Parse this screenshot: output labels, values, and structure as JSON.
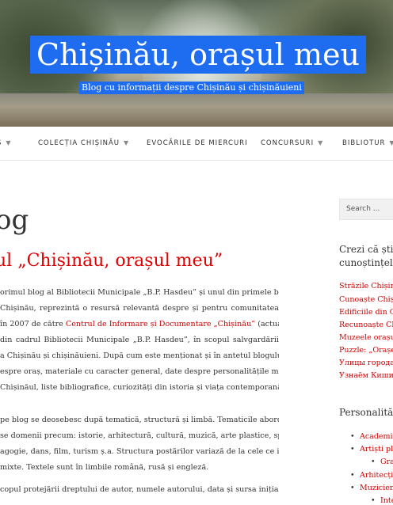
{
  "site": {
    "title": "Chișinău, orașul meu",
    "tagline": "Blog cu informații despre Chișinău și chișinăuieni"
  },
  "nav": {
    "items": [
      {
        "label": "Ș"
      },
      {
        "label": "COLECȚIA CHIȘINĂU"
      },
      {
        "label": "EVOCĂRILE DE MIERCURI"
      },
      {
        "label": "CONCURSURI"
      },
      {
        "label": "BIBLIOTUR"
      }
    ]
  },
  "main": {
    "heading": "og",
    "post_title": "ul „Chișinău, orașul meu”",
    "para1": [
      "orimul blog al Bibliotecii Municipale „B.P. Hasdeu” și unul din primele bloguri",
      "Chișinău, reprezintă o resursă relevantă despre și pentru comunitatea",
      {
        "pre": "în 2007 de către ",
        "link": "Centrul de Informare și Documentare „Chișinău”",
        "post": " (actualmente"
      },
      "din cadrul Bibliotecii Municipale „B.P. Hasdeu”, în scopul salvgardării",
      "a Chișinău și chișinăuieni. După cum este menționat și în antetul blogului în",
      "espre oraș, materiale cu caracter general, date despre personalitățile marcante",
      "Chișinăul, liste bibliografice, curiozități din istoria și viața contemporană a"
    ],
    "para2": [
      "pe blog se deosebesc după tematică, structură și limbă. Tematicile abordate",
      "se domenii precum: istorie, arhitectură, cultură, muzică, arte plastice, sport,",
      "agogie, dans, film, turism ș.a. Structura postărilor variază de la cele ce includ",
      "mixte. Textele sunt în limbile română, rusă și engleză."
    ],
    "para3": [
      "copul protejării dreptului de autor, numele autorului, data și sursa inițială a"
    ]
  },
  "sidebar": {
    "search_placeholder": "Search ...",
    "widget1_title_line1": "Crezi că știi C",
    "widget1_title_line2": "cunoștințele!",
    "quiz_links": [
      "Străzile Chișină",
      "Cunoaște Chișin",
      "Edificiile din Ch",
      "Recunoaște Chi",
      "Muzeele orașul",
      "Puzzle: „Orașe î",
      "Улицы города",
      "Узнаём Кишин"
    ],
    "widget2_title": "Personalități",
    "personalities": [
      {
        "label": "Academic",
        "level": 1
      },
      {
        "label": "Artiști pla",
        "level": 1
      },
      {
        "label": "Gra",
        "level": 2
      },
      {
        "label": "Arhitecți",
        "level": 1
      },
      {
        "label": "Muzicien",
        "level": 1
      },
      {
        "label": "Inte",
        "level": 2
      }
    ]
  }
}
